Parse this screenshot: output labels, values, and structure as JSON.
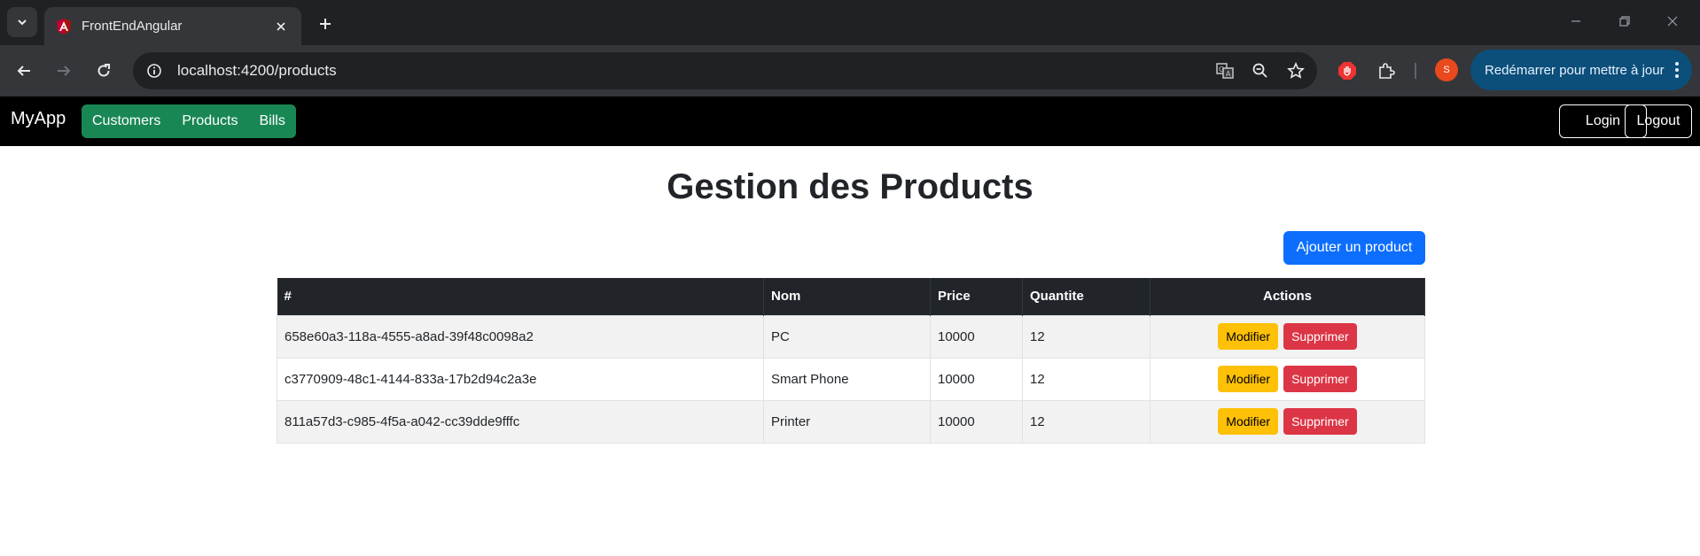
{
  "browser": {
    "tab_title": "FrontEndAngular",
    "url": "localhost:4200/products",
    "update_button_label": "Redémarrer pour mettre à jour",
    "profile_initial": "S"
  },
  "navbar": {
    "brand": "MyApp",
    "links": [
      "Customers",
      "Products",
      "Bills"
    ],
    "login_label": "Login",
    "logout_label": "Logout"
  },
  "page": {
    "title": "Gestion des Products",
    "add_button_label": "Ajouter un product"
  },
  "table": {
    "headers": [
      "#",
      "Nom",
      "Price",
      "Quantite",
      "Actions"
    ],
    "rows": [
      {
        "id": "658e60a3-118a-4555-a8ad-39f48c0098a2",
        "name": "PC",
        "price": "10000",
        "quantity": "12"
      },
      {
        "id": "c3770909-48c1-4144-833a-17b2d94c2a3e",
        "name": "Smart Phone",
        "price": "10000",
        "quantity": "12"
      },
      {
        "id": "811a57d3-c985-4f5a-a042-cc39dde9fffc",
        "name": "Printer",
        "price": "10000",
        "quantity": "12"
      }
    ],
    "modify_label": "Modifier",
    "delete_label": "Supprimer"
  },
  "colors": {
    "nav_link_bg": "#198754",
    "add_button_bg": "#0d6efd",
    "modify_button_bg": "#ffc107",
    "delete_button_bg": "#dc3545",
    "table_header_bg": "#212529"
  }
}
